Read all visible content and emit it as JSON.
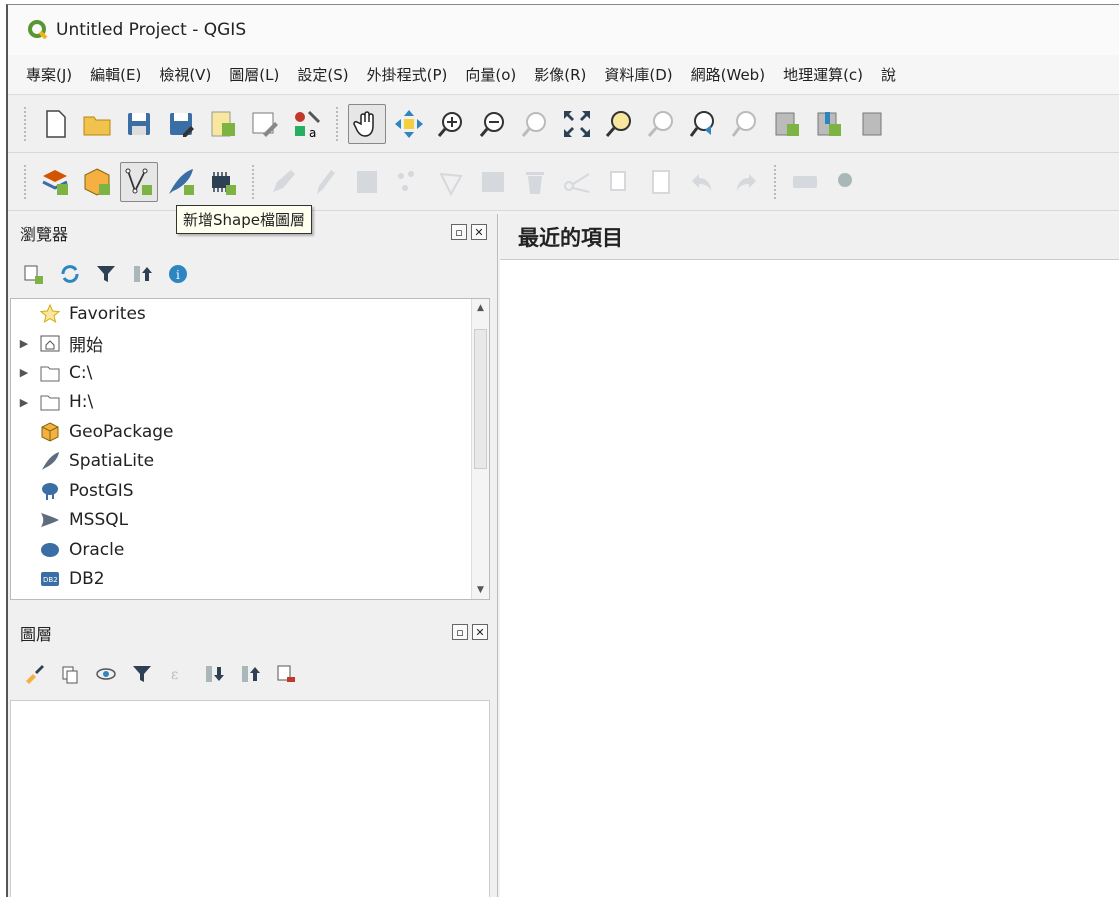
{
  "window": {
    "title": "Untitled Project - QGIS"
  },
  "menu": [
    "專案(J)",
    "編輯(E)",
    "檢視(V)",
    "圖層(L)",
    "設定(S)",
    "外掛程式(P)",
    "向量(o)",
    "影像(R)",
    "資料庫(D)",
    "網路(Web)",
    "地理運算(c)",
    "說"
  ],
  "tooltip": {
    "text": "新增Shape檔圖層"
  },
  "browser": {
    "title": "瀏覽器",
    "items": [
      {
        "label": "Favorites",
        "icon": "star-icon"
      },
      {
        "label": "開始",
        "icon": "home-folder-icon"
      },
      {
        "label": "C:\\",
        "icon": "folder-icon"
      },
      {
        "label": "H:\\",
        "icon": "folder-icon"
      },
      {
        "label": "GeoPackage",
        "icon": "geopackage-icon"
      },
      {
        "label": "SpatiaLite",
        "icon": "spatialite-icon"
      },
      {
        "label": "PostGIS",
        "icon": "postgis-icon"
      },
      {
        "label": "MSSQL",
        "icon": "mssql-icon"
      },
      {
        "label": "Oracle",
        "icon": "oracle-icon"
      },
      {
        "label": "DB2",
        "icon": "db2-icon"
      }
    ]
  },
  "layers": {
    "title": "圖層"
  },
  "recent": {
    "title": "最近的項目"
  },
  "colors": {
    "accent": "#589632",
    "folder": "#f2c24f",
    "db_blue": "#3a6ea5"
  }
}
